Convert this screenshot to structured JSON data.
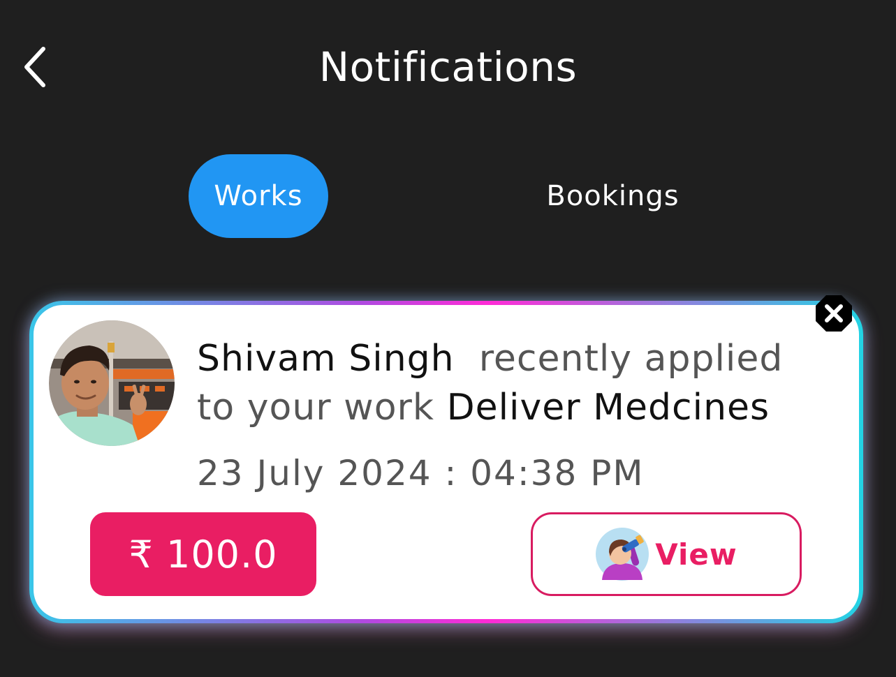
{
  "header": {
    "title": "Notifications",
    "back_icon": "chevron-left-icon"
  },
  "tabs": [
    {
      "label": "Works",
      "active": true
    },
    {
      "label": "Bookings",
      "active": false
    }
  ],
  "notification": {
    "user_name": "Shivam Singh",
    "message_middle": "recently applied to your work",
    "work_title": "Deliver Medcines",
    "timestamp": "23 July 2024 : 04:38 PM",
    "price": "₹ 100.0",
    "view_label": "View",
    "view_icon": "person-binoculars-icon",
    "close_icon": "close-icon",
    "avatar": "user-avatar-photo"
  },
  "colors": {
    "background": "#1f1f1f",
    "tab_active": "#2196f3",
    "accent": "#e91e63",
    "card": "#ffffff"
  }
}
